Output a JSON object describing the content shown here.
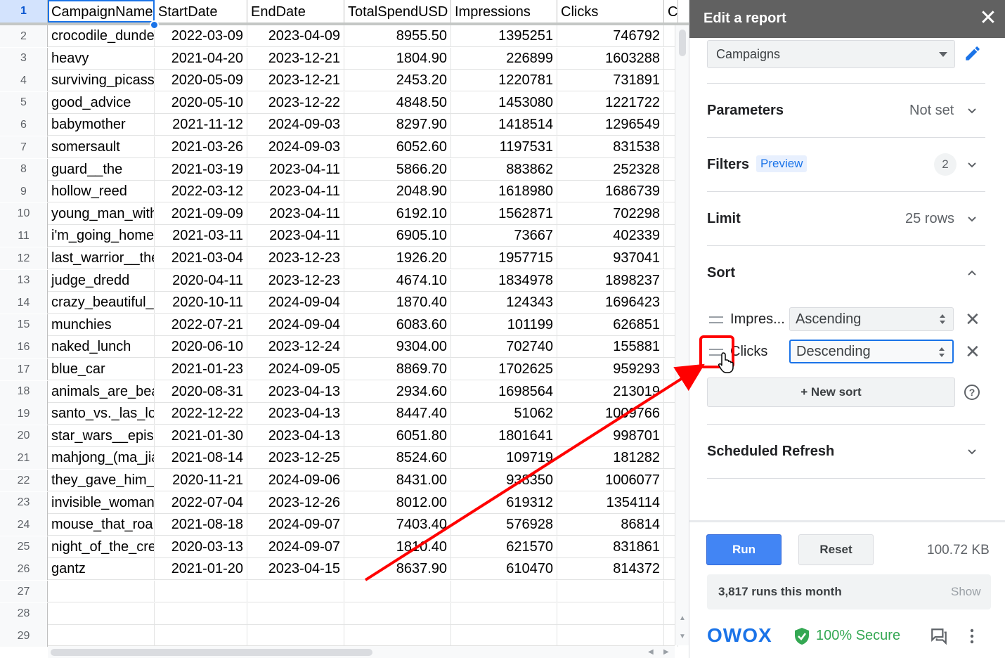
{
  "sheet": {
    "columns": [
      "CampaignName",
      "StartDate",
      "EndDate",
      "TotalSpendUSD",
      "Impressions",
      "Clicks",
      "C"
    ],
    "rows": [
      {
        "num": "2",
        "cells": [
          "crocodile_dundee",
          "2022-03-09",
          "2023-04-09",
          "8955.50",
          "1395251",
          "746792"
        ]
      },
      {
        "num": "3",
        "cells": [
          "heavy",
          "2021-04-20",
          "2023-12-21",
          "1804.90",
          "226899",
          "1603288"
        ]
      },
      {
        "num": "4",
        "cells": [
          "surviving_picasso",
          "2020-05-09",
          "2023-12-21",
          "2453.20",
          "1220781",
          "731891"
        ]
      },
      {
        "num": "5",
        "cells": [
          "good_advice",
          "2020-05-10",
          "2023-12-22",
          "4848.50",
          "1453080",
          "1221722"
        ]
      },
      {
        "num": "6",
        "cells": [
          "babymother",
          "2021-11-12",
          "2024-09-03",
          "8297.90",
          "1418514",
          "1296549"
        ]
      },
      {
        "num": "7",
        "cells": [
          "somersault",
          "2021-03-26",
          "2024-09-03",
          "6052.60",
          "1197531",
          "831538"
        ]
      },
      {
        "num": "8",
        "cells": [
          "guard__the",
          "2021-03-19",
          "2023-04-11",
          "5866.20",
          "883862",
          "252328"
        ]
      },
      {
        "num": "9",
        "cells": [
          "hollow_reed",
          "2022-03-12",
          "2023-04-11",
          "2048.90",
          "1618980",
          "1686739"
        ]
      },
      {
        "num": "10",
        "cells": [
          "young_man_with",
          "2021-09-09",
          "2023-04-11",
          "6192.10",
          "1562871",
          "702298"
        ]
      },
      {
        "num": "11",
        "cells": [
          "i'm_going_home",
          "2021-03-11",
          "2023-04-11",
          "6905.10",
          "73667",
          "402339"
        ]
      },
      {
        "num": "12",
        "cells": [
          "last_warrior__the",
          "2021-03-04",
          "2023-12-23",
          "1926.20",
          "1957715",
          "937041"
        ]
      },
      {
        "num": "13",
        "cells": [
          "judge_dredd",
          "2020-04-11",
          "2023-12-23",
          "4674.10",
          "1834978",
          "1898237"
        ]
      },
      {
        "num": "14",
        "cells": [
          "crazy_beautiful_",
          "2020-10-11",
          "2024-09-04",
          "1870.40",
          "124343",
          "1696423"
        ]
      },
      {
        "num": "15",
        "cells": [
          "munchies",
          "2022-07-21",
          "2024-09-04",
          "6083.60",
          "101199",
          "626851"
        ]
      },
      {
        "num": "16",
        "cells": [
          "naked_lunch",
          "2020-06-10",
          "2023-12-24",
          "9304.00",
          "702740",
          "155881"
        ]
      },
      {
        "num": "17",
        "cells": [
          "blue_car",
          "2021-01-23",
          "2024-09-05",
          "8869.70",
          "1702625",
          "959293"
        ]
      },
      {
        "num": "18",
        "cells": [
          "animals_are_bea",
          "2020-08-31",
          "2023-04-13",
          "2934.60",
          "1698564",
          "213019"
        ]
      },
      {
        "num": "19",
        "cells": [
          "santo_vs._las_lo",
          "2022-12-22",
          "2023-04-13",
          "8447.40",
          "51062",
          "1009766"
        ]
      },
      {
        "num": "20",
        "cells": [
          "star_wars__epis",
          "2021-01-30",
          "2023-04-13",
          "6051.80",
          "1801641",
          "998701"
        ]
      },
      {
        "num": "21",
        "cells": [
          "mahjong_(ma_jia",
          "2021-08-14",
          "2023-12-25",
          "8524.60",
          "109719",
          "181282"
        ]
      },
      {
        "num": "22",
        "cells": [
          "they_gave_him_",
          "2020-11-21",
          "2024-09-06",
          "8431.00",
          "938350",
          "1006077"
        ]
      },
      {
        "num": "23",
        "cells": [
          "invisible_woman",
          "2022-07-04",
          "2023-12-26",
          "8012.00",
          "619312",
          "1354114"
        ]
      },
      {
        "num": "24",
        "cells": [
          "mouse_that_roa",
          "2021-08-18",
          "2024-09-07",
          "7403.40",
          "576928",
          "86814"
        ]
      },
      {
        "num": "25",
        "cells": [
          "night_of_the_cre",
          "2020-03-13",
          "2024-09-07",
          "1810.40",
          "621570",
          "831861"
        ]
      },
      {
        "num": "26",
        "cells": [
          "gantz",
          "2021-01-20",
          "2023-04-15",
          "8637.90",
          "610470",
          "814372"
        ]
      },
      {
        "num": "27",
        "cells": [
          "",
          "",
          "",
          "",
          "",
          ""
        ]
      },
      {
        "num": "28",
        "cells": [
          "",
          "",
          "",
          "",
          "",
          ""
        ]
      },
      {
        "num": "29",
        "cells": [
          "",
          "",
          "",
          "",
          "",
          ""
        ]
      }
    ]
  },
  "panel": {
    "title": "Edit a report",
    "close_icon": "close-icon",
    "report_select": "Campaigns",
    "edit_icon": "pencil-icon",
    "parameters": {
      "label": "Parameters",
      "value": "Not set"
    },
    "filters": {
      "label": "Filters",
      "badge": "Preview",
      "count": "2"
    },
    "limit": {
      "label": "Limit",
      "value": "25 rows"
    },
    "sort": {
      "label": "Sort",
      "items": [
        {
          "field": "Impres...",
          "order": "Ascending"
        },
        {
          "field": "Clicks",
          "order": "Descending"
        }
      ],
      "new_sort": "+ New sort",
      "help_icon": "question-icon"
    },
    "scheduled_refresh": {
      "label": "Scheduled Refresh"
    },
    "run_label": "Run",
    "reset_label": "Reset",
    "size": "100.72 KB",
    "runs_text": "3,817 runs this month",
    "show_label": "Show",
    "brand": "OWOX",
    "secure_text": "100% Secure",
    "colors": {
      "accent": "#4285f4",
      "brand": "#1a73e8",
      "secure": "#34a853",
      "annotation": "#ff0000"
    }
  }
}
